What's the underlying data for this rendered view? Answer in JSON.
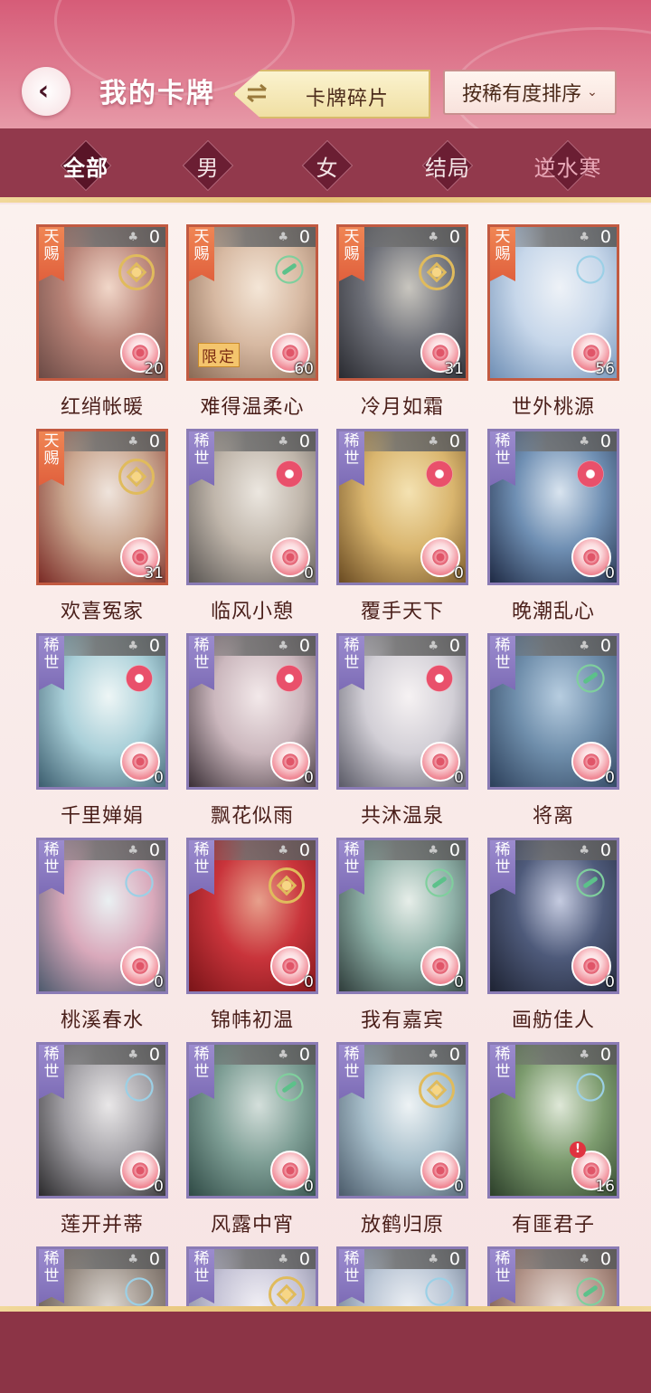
{
  "header": {
    "title": "我的卡牌",
    "fragment_button": "卡牌碎片",
    "sort_button": "按稀有度排序",
    "sort_dropdown_glyph": "⌄"
  },
  "tabs": [
    {
      "label": "全部",
      "active": true
    },
    {
      "label": "男",
      "active": false
    },
    {
      "label": "女",
      "active": false
    },
    {
      "label": "结局",
      "active": false
    },
    {
      "label": "逆水寒",
      "active": false
    }
  ],
  "cards": [
    {
      "name": "红绡帐暖",
      "tier": "天赐",
      "count": "0",
      "level": "20",
      "emblem": "gold-coin-icon",
      "art": [
        "#6b4a45",
        "#b98478",
        "#f1d7c9"
      ]
    },
    {
      "name": "难得温柔心",
      "tier": "天赐",
      "count": "0",
      "level": "60",
      "emblem": "leaf-icon",
      "limited": "限定",
      "art": [
        "#8a6a55",
        "#d7b9a2",
        "#f4e6d7"
      ]
    },
    {
      "name": "冷月如霜",
      "tier": "天赐",
      "count": "0",
      "level": "31",
      "emblem": "gold-coin-icon",
      "art": [
        "#2a2b31",
        "#6f7179",
        "#c9c6bf"
      ]
    },
    {
      "name": "世外桃源",
      "tier": "天赐",
      "count": "0",
      "level": "56",
      "emblem": "fan-icon",
      "art": [
        "#6f8fb5",
        "#c7d7ea",
        "#eef2f7"
      ]
    },
    {
      "name": "欢喜冤家",
      "tier": "天赐",
      "count": "0",
      "level": "31",
      "emblem": "gold-coin-icon",
      "art": [
        "#7a2a25",
        "#c9a58e",
        "#efe4dc"
      ]
    },
    {
      "name": "临风小憩",
      "tier": "稀世",
      "count": "0",
      "level": "0",
      "emblem": "flower-icon",
      "art": [
        "#5a5653",
        "#c0b6ab",
        "#ece7e0"
      ]
    },
    {
      "name": "覆手天下",
      "tier": "稀世",
      "count": "0",
      "level": "0",
      "emblem": "flower-icon",
      "art": [
        "#6a4b22",
        "#d9b56e",
        "#f4e2b2"
      ]
    },
    {
      "name": "晚潮乱心",
      "tier": "稀世",
      "count": "0",
      "level": "0",
      "emblem": "flower-icon",
      "art": [
        "#1f2a44",
        "#6f8fb3",
        "#d9e4ef"
      ]
    },
    {
      "name": "千里婵娟",
      "tier": "稀世",
      "count": "0",
      "level": "0",
      "emblem": "flower-icon",
      "art": [
        "#3b5d6e",
        "#a9cfd8",
        "#eef6f6"
      ]
    },
    {
      "name": "飘花似雨",
      "tier": "稀世",
      "count": "0",
      "level": "0",
      "emblem": "flower-icon",
      "art": [
        "#3a2f36",
        "#cbb7bd",
        "#f3e9ea"
      ]
    },
    {
      "name": "共沐温泉",
      "tier": "稀世",
      "count": "0",
      "level": "0",
      "emblem": "flower-icon",
      "art": [
        "#5a5a66",
        "#d2cfd6",
        "#f6f2f3"
      ]
    },
    {
      "name": "将离",
      "tier": "稀世",
      "count": "0",
      "level": "0",
      "emblem": "leaf-icon",
      "art": [
        "#2c3f5a",
        "#6f8eab",
        "#b7cde0"
      ]
    },
    {
      "name": "桃溪春水",
      "tier": "稀世",
      "count": "0",
      "level": "0",
      "emblem": "fan-icon",
      "art": [
        "#4d5a6d",
        "#d9a9bb",
        "#eaf0f2"
      ]
    },
    {
      "name": "锦帏初温",
      "tier": "稀世",
      "count": "0",
      "level": "0",
      "emblem": "gold-coin-icon",
      "art": [
        "#7a1418",
        "#c9343b",
        "#e7a08c"
      ]
    },
    {
      "name": "我有嘉宾",
      "tier": "稀世",
      "count": "0",
      "level": "0",
      "emblem": "leaf-icon",
      "art": [
        "#2f3d3b",
        "#8fb1a8",
        "#e7eee9"
      ]
    },
    {
      "name": "画舫佳人",
      "tier": "稀世",
      "count": "0",
      "level": "0",
      "emblem": "leaf-icon",
      "art": [
        "#1e2333",
        "#4e5a7a",
        "#c5cbe0"
      ]
    },
    {
      "name": "莲开并蒂",
      "tier": "稀世",
      "count": "0",
      "level": "0",
      "emblem": "fan-icon",
      "art": [
        "#2b2a2c",
        "#a3a1a6",
        "#e9e7e8"
      ]
    },
    {
      "name": "风露中宵",
      "tier": "稀世",
      "count": "0",
      "level": "0",
      "emblem": "leaf-icon",
      "art": [
        "#2f4a45",
        "#7f9f96",
        "#d4dfdb"
      ]
    },
    {
      "name": "放鹤归原",
      "tier": "稀世",
      "count": "0",
      "level": "0",
      "emblem": "gold-coin-icon",
      "art": [
        "#4b5b6a",
        "#a8bfcb",
        "#eef3f5"
      ]
    },
    {
      "name": "有匪君子",
      "tier": "稀世",
      "count": "0",
      "level": "16",
      "emblem": "fan-icon",
      "alert": "!",
      "art": [
        "#2c3f2a",
        "#7c9b6e",
        "#dfe8d8"
      ]
    },
    {
      "name": "",
      "tier": "稀世",
      "count": "0",
      "level": "",
      "emblem": "fan-icon",
      "art": [
        "#4a3f3a",
        "#9a8f86",
        "#e0dbd6"
      ]
    },
    {
      "name": "",
      "tier": "稀世",
      "count": "0",
      "level": "",
      "emblem": "gold-coin-icon",
      "art": [
        "#6b6f87",
        "#c5c3d6",
        "#f3f1f6"
      ]
    },
    {
      "name": "",
      "tier": "稀世",
      "count": "0",
      "level": "",
      "emblem": "fan-icon",
      "art": [
        "#4f5d72",
        "#b7c3d3",
        "#eef1f5"
      ]
    },
    {
      "name": "",
      "tier": "稀世",
      "count": "0",
      "level": "",
      "emblem": "leaf-icon",
      "art": [
        "#5a3a30",
        "#b3958a",
        "#e9dfda"
      ]
    }
  ],
  "colors": {
    "header_pink": "#d65c78",
    "filter_bar": "#92394c",
    "gold_rule": "#e3be6f",
    "tier_orange": "#e0603d",
    "tier_purple": "#7d6cb6"
  }
}
